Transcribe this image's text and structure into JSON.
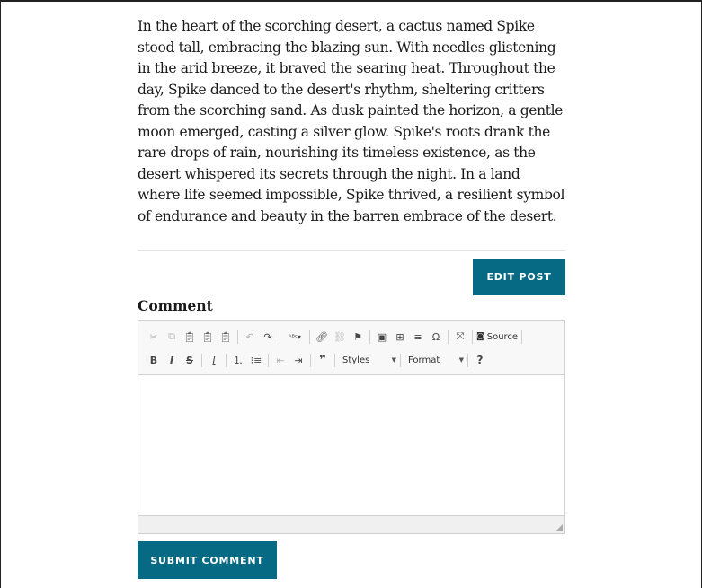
{
  "post": {
    "body": "In the heart of the scorching desert, a cactus named Spike stood tall, embracing the blazing sun. With needles glistening in the arid breeze, it braved the searing heat. Throughout the day, Spike danced to the desert's rhythm, sheltering critters from the scorching sand. As dusk painted the horizon, a gentle moon emerged, casting a silver glow. Spike's roots drank the rare drops of rain, nourishing its timeless existence, as the desert whispered its secrets through the night. In a land where life seemed impossible, Spike thrived, a resilient symbol of endurance and beauty in the barren embrace of the desert.",
    "edit_button": "EDIT POST"
  },
  "comment": {
    "label": "Comment",
    "submit_button": "SUBMIT COMMENT"
  },
  "toolbar": {
    "source_label": "Source",
    "styles_label": "Styles",
    "format_label": "Format",
    "bold": "B",
    "italic": "I",
    "strike": "S",
    "help": "?"
  },
  "colors": {
    "accent": "#066a85",
    "toolbar_bg": "#f8f8f8",
    "border": "#d1d1d1"
  }
}
